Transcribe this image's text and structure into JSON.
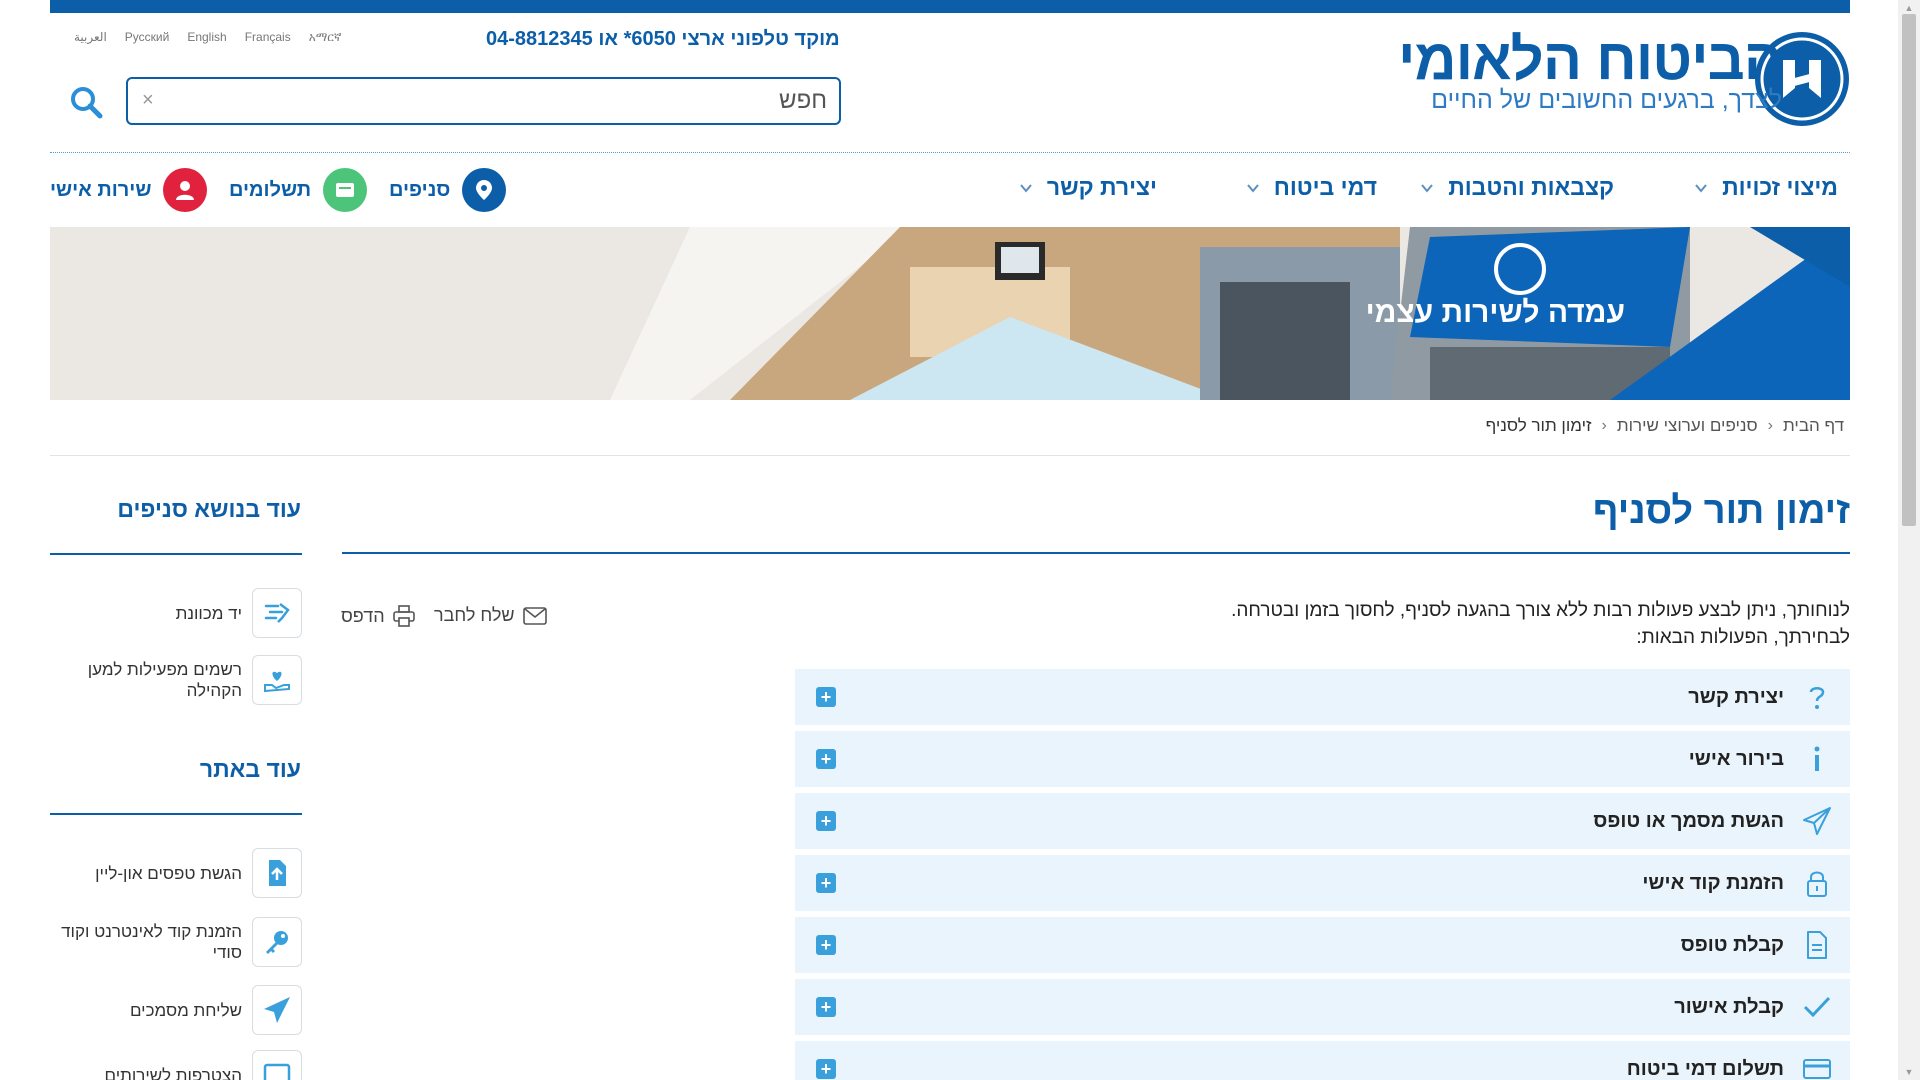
{
  "header": {
    "brand_title": "הביטוח הלאומי",
    "brand_subtitle": "לצדך, ברגעים החשובים של החיים",
    "hotline": "מוקד טלפוני ארצי ‎*6050 או 04-8812345",
    "languages": [
      "العربية",
      "Русский",
      "English",
      "Français",
      "አማርኛ"
    ],
    "search": {
      "placeholder": "חפש",
      "value": "",
      "clear_symbol": "×"
    }
  },
  "nav": {
    "menu": [
      {
        "label": "מיצוי זכויות"
      },
      {
        "label": "קצבאות והטבות"
      },
      {
        "label": "דמי ביטוח"
      },
      {
        "label": "יצירת קשר"
      }
    ],
    "quick_links": [
      {
        "label": "סניפים",
        "icon": "location-pin-icon",
        "color": "#0d5ea8"
      },
      {
        "label": "תשלומים",
        "icon": "wallet-icon",
        "color": "#4cc47a"
      },
      {
        "label": "שירות אישי",
        "icon": "user-icon",
        "color": "#e0223e"
      }
    ]
  },
  "banner": {
    "kiosk_sign": "עמדה לשירות עצמי"
  },
  "breadcrumb": [
    "דף הבית",
    "סניפים וערוצי שירות",
    "זימון תור לסניף"
  ],
  "main": {
    "title": "זימון תור לסניף",
    "intro_line1": "לנוחותך, ניתן לבצע פעולות רבות ללא צורך בהגעה לסניף, לחסוך בזמן ובטרחה.",
    "intro_line2": "לבחירתך, הפעולות הבאות:",
    "send_to_friend": "שלח לחבר",
    "print": "הדפס",
    "accordion": [
      {
        "label": "יצירת קשר",
        "icon": "question-icon"
      },
      {
        "label": "בירור אישי",
        "icon": "info-icon"
      },
      {
        "label": "הגשת מסמך או טופס",
        "icon": "paper-plane-icon"
      },
      {
        "label": "הזמנת קוד אישי",
        "icon": "lock-icon"
      },
      {
        "label": "קבלת טופס",
        "icon": "document-icon"
      },
      {
        "label": "קבלת אישור",
        "icon": "checkmark-icon"
      },
      {
        "label": "תשלום דמי ביטוח",
        "icon": "credit-card-icon"
      }
    ],
    "accordion_toggle": "+"
  },
  "sidebar": {
    "section1_title": "עוד בנושא סניפים",
    "section1_items": [
      {
        "label": "יד מכוונת",
        "icon": "guiding-hand-icon"
      },
      {
        "label": "רשמים מפעילות למען הקהילה",
        "icon": "heart-hand-icon"
      }
    ],
    "section2_title": "עוד באתר",
    "section2_items": [
      {
        "label": "הגשת טפסים און-ליין",
        "icon": "upload-file-icon"
      },
      {
        "label": "הזמנת קוד לאינטרנט וקוד סודי",
        "icon": "key-icon"
      },
      {
        "label": "שליחת מסמכים",
        "icon": "paper-plane-icon"
      },
      {
        "label": "הצטרפות לשירותים",
        "icon": "window-icon"
      }
    ]
  },
  "colors": {
    "primary": "#0d5ea8",
    "accent": "#39a0dc",
    "accordion_bg": "#eaf4fc"
  }
}
